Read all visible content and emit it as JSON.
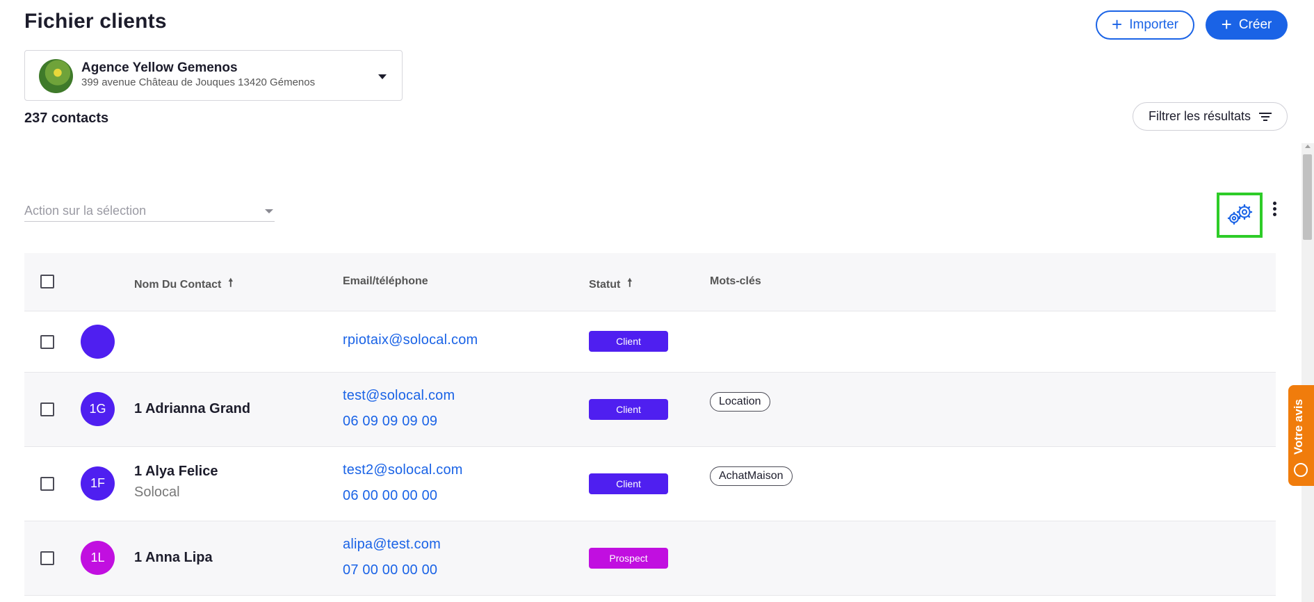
{
  "header": {
    "title": "Fichier clients",
    "import_label": "Importer",
    "create_label": "Créer"
  },
  "agency": {
    "name": "Agence Yellow Gemenos",
    "address": "399 avenue Château de Jouques 13420 Gémenos"
  },
  "contacts_count": "237 contacts",
  "filter_label": "Filtrer les résultats",
  "action_select": {
    "placeholder": "Action sur la sélection"
  },
  "table": {
    "headers": {
      "name": "Nom Du Contact",
      "contact": "Email/téléphone",
      "status": "Statut",
      "keywords": "Mots-clés"
    },
    "rows": [
      {
        "initials": "",
        "name": "",
        "company": "",
        "email": "rpiotaix@solocal.com",
        "phone": "",
        "status": "Client",
        "status_color": "#4f1ff0",
        "avatar_color": "#4f1ff0",
        "tag": ""
      },
      {
        "initials": "1G",
        "name": "1 Adrianna Grand",
        "company": "",
        "email": "test@solocal.com",
        "phone": "06 09 09 09 09",
        "status": "Client",
        "status_color": "#4f1ff0",
        "avatar_color": "#4f1ff0",
        "tag": "Location"
      },
      {
        "initials": "1F",
        "name": "1 Alya Felice",
        "company": "Solocal",
        "email": "test2@solocal.com",
        "phone": "06 00 00 00 00",
        "status": "Client",
        "status_color": "#4f1ff0",
        "avatar_color": "#4f1ff0",
        "tag": "AchatMaison"
      },
      {
        "initials": "1L",
        "name": "1 Anna Lipa",
        "company": "",
        "email": "alipa@test.com",
        "phone": "07 00 00 00 00",
        "status": "Prospect",
        "status_color": "#c10fe0",
        "avatar_color": "#c10fe0",
        "tag": ""
      }
    ]
  },
  "feedback_label": "Votre avis",
  "colors": {
    "primary": "#1a63e6",
    "highlight": "#2ecc28",
    "feedback": "#f07c0c"
  },
  "icons": {
    "settings": "gears-icon",
    "more": "kebab-menu-icon",
    "filter": "filter-icon",
    "sort": "arrow-up-icon"
  }
}
